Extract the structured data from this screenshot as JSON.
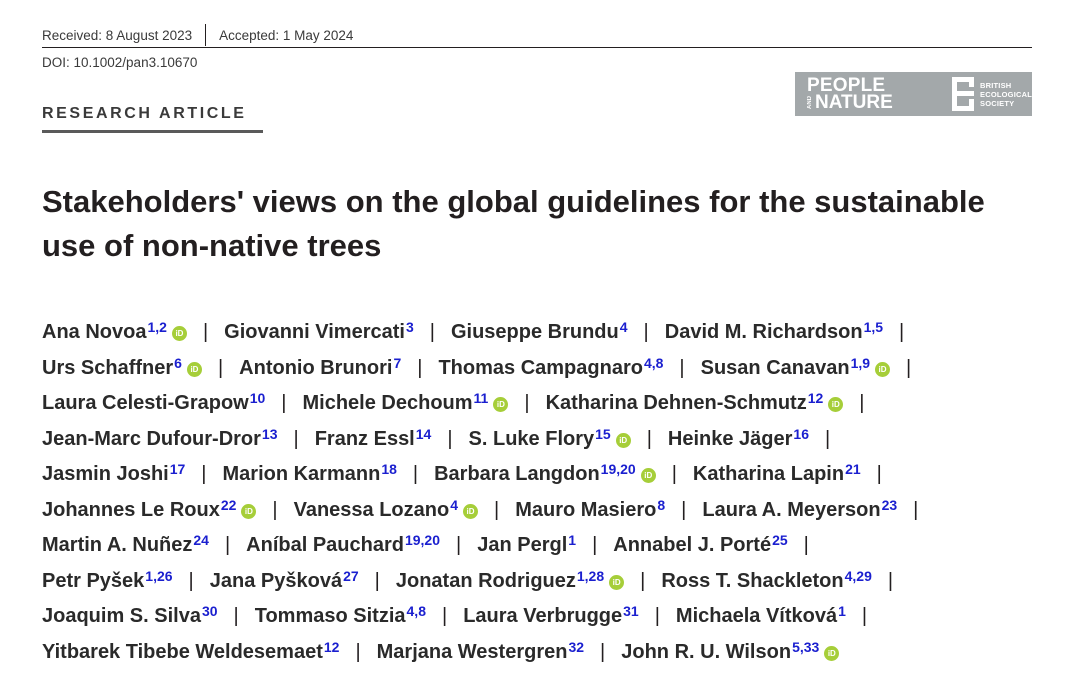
{
  "header": {
    "received": "Received: 8 August 2023",
    "accepted": "Accepted: 1 May 2024",
    "doi": "DOI: 10.1002/pan3.10670"
  },
  "logo": {
    "people": "PEOPLE",
    "and": "AND",
    "nature": "NATURE",
    "society": [
      "BRITISH",
      "ECOLOGICAL",
      "SOCIETY"
    ]
  },
  "article_type": "RESEARCH ARTICLE",
  "title_lines": [
    "Stakeholders' views on the global guidelines for the sustainable",
    "use of non-native trees"
  ],
  "orcid_label": "iD",
  "separator": "|",
  "author_lines": [
    {
      "trailing_sep": true,
      "authors": [
        {
          "name": "Ana Novoa",
          "aff": "1,2",
          "orcid": true
        },
        {
          "name": "Giovanni Vimercati",
          "aff": "3",
          "orcid": false
        },
        {
          "name": "Giuseppe Brundu",
          "aff": "4",
          "orcid": false
        },
        {
          "name": "David M. Richardson",
          "aff": "1,5",
          "orcid": false
        }
      ]
    },
    {
      "trailing_sep": true,
      "authors": [
        {
          "name": "Urs Schaffner",
          "aff": "6",
          "orcid": true
        },
        {
          "name": "Antonio Brunori",
          "aff": "7",
          "orcid": false
        },
        {
          "name": "Thomas Campagnaro",
          "aff": "4,8",
          "orcid": false
        },
        {
          "name": "Susan Canavan",
          "aff": "1,9",
          "orcid": true
        }
      ]
    },
    {
      "trailing_sep": true,
      "authors": [
        {
          "name": "Laura Celesti-Grapow",
          "aff": "10",
          "orcid": false
        },
        {
          "name": "Michele Dechoum",
          "aff": "11",
          "orcid": true
        },
        {
          "name": "Katharina Dehnen-Schmutz",
          "aff": "12",
          "orcid": true
        }
      ]
    },
    {
      "trailing_sep": true,
      "authors": [
        {
          "name": "Jean-Marc Dufour-Dror",
          "aff": "13",
          "orcid": false
        },
        {
          "name": "Franz Essl",
          "aff": "14",
          "orcid": false
        },
        {
          "name": "S. Luke Flory",
          "aff": "15",
          "orcid": true
        },
        {
          "name": "Heinke Jäger",
          "aff": "16",
          "orcid": false
        }
      ]
    },
    {
      "trailing_sep": true,
      "authors": [
        {
          "name": "Jasmin Joshi",
          "aff": "17",
          "orcid": false
        },
        {
          "name": "Marion Karmann",
          "aff": "18",
          "orcid": false
        },
        {
          "name": "Barbara Langdon",
          "aff": "19,20",
          "orcid": true
        },
        {
          "name": "Katharina Lapin",
          "aff": "21",
          "orcid": false
        }
      ]
    },
    {
      "trailing_sep": true,
      "authors": [
        {
          "name": "Johannes Le Roux",
          "aff": "22",
          "orcid": true
        },
        {
          "name": "Vanessa Lozano",
          "aff": "4",
          "orcid": true
        },
        {
          "name": "Mauro Masiero",
          "aff": "8",
          "orcid": false
        },
        {
          "name": "Laura A. Meyerson",
          "aff": "23",
          "orcid": false
        }
      ]
    },
    {
      "trailing_sep": true,
      "authors": [
        {
          "name": "Martin A. Nuñez",
          "aff": "24",
          "orcid": false
        },
        {
          "name": "Aníbal Pauchard",
          "aff": "19,20",
          "orcid": false
        },
        {
          "name": "Jan Pergl",
          "aff": "1",
          "orcid": false
        },
        {
          "name": "Annabel J. Porté",
          "aff": "25",
          "orcid": false
        }
      ]
    },
    {
      "trailing_sep": true,
      "authors": [
        {
          "name": "Petr Pyšek",
          "aff": "1,26",
          "orcid": false
        },
        {
          "name": "Jana Pyšková",
          "aff": "27",
          "orcid": false
        },
        {
          "name": "Jonatan Rodriguez",
          "aff": "1,28",
          "orcid": true
        },
        {
          "name": "Ross T. Shackleton",
          "aff": "4,29",
          "orcid": false
        }
      ]
    },
    {
      "trailing_sep": true,
      "authors": [
        {
          "name": "Joaquim S. Silva",
          "aff": "30",
          "orcid": false
        },
        {
          "name": "Tommaso Sitzia",
          "aff": "4,8",
          "orcid": false
        },
        {
          "name": "Laura Verbrugge",
          "aff": "31",
          "orcid": false
        },
        {
          "name": "Michaela Vítková",
          "aff": "1",
          "orcid": false
        }
      ]
    },
    {
      "trailing_sep": false,
      "authors": [
        {
          "name": "Yitbarek Tibebe Weldesemaet",
          "aff": "12",
          "orcid": false
        },
        {
          "name": "Marjana Westergren",
          "aff": "32",
          "orcid": false
        },
        {
          "name": "John R. U. Wilson",
          "aff": "5,33",
          "orcid": true
        }
      ]
    }
  ]
}
